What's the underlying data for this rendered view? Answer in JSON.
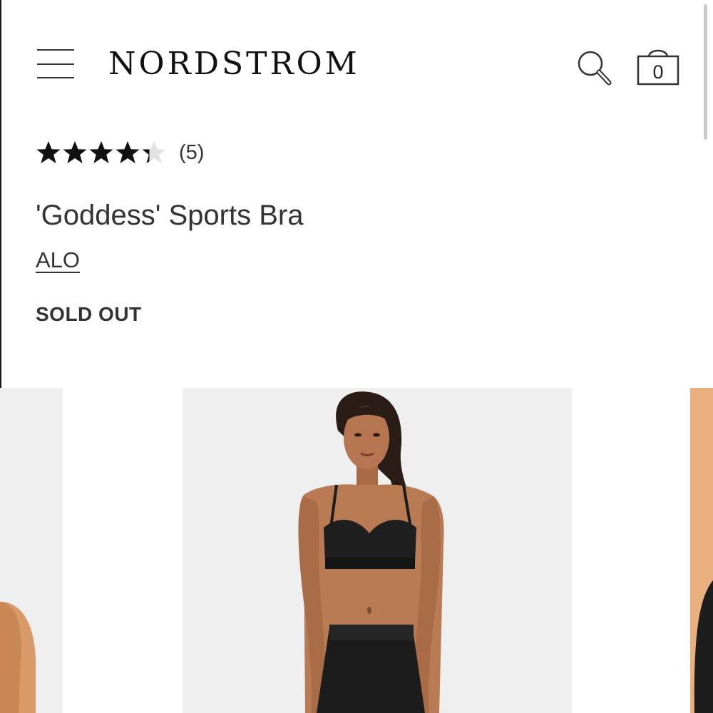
{
  "header": {
    "logo_text": "NORDSTROM",
    "bag_count": "0",
    "menu_icon": "hamburger-menu-icon",
    "search_icon": "search-icon",
    "bag_icon": "shopping-bag-icon"
  },
  "product": {
    "rating": 4.3,
    "rating_max": 5,
    "review_count": "(5)",
    "title": "'Goddess' Sports Bra",
    "brand": "ALO",
    "availability": "SOLD OUT"
  },
  "colors": {
    "star_filled": "#111111",
    "star_empty": "#e2e2e2",
    "image_background": "#efefef"
  }
}
